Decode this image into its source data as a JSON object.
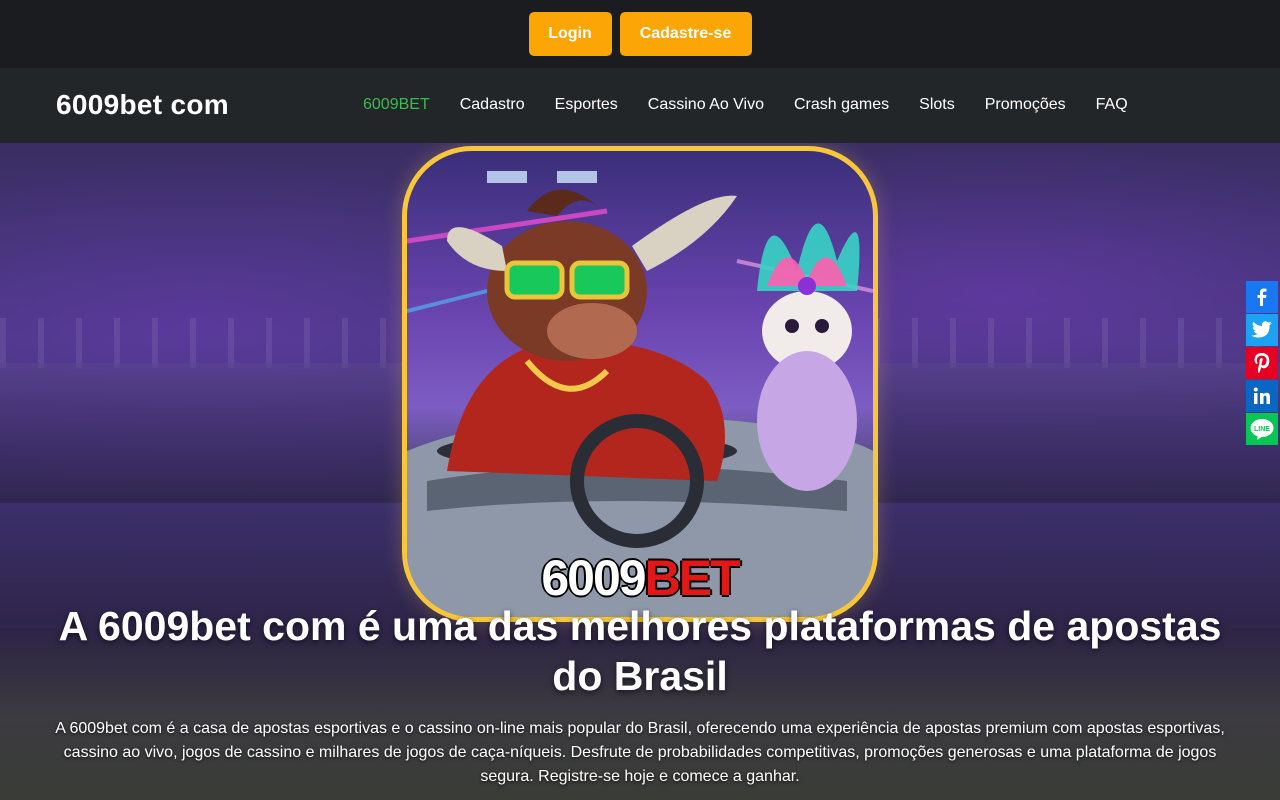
{
  "header": {
    "login_label": "Login",
    "signup_label": "Cadastre-se"
  },
  "navbar": {
    "brand": "6009bet com",
    "items": [
      {
        "label": "6009BET",
        "active": true
      },
      {
        "label": "Cadastro"
      },
      {
        "label": "Esportes"
      },
      {
        "label": "Cassino Ao Vivo"
      },
      {
        "label": "Crash games"
      },
      {
        "label": "Slots"
      },
      {
        "label": "Promoções"
      },
      {
        "label": "FAQ"
      }
    ]
  },
  "hero": {
    "promo_logo_number": "6009",
    "promo_logo_text": "BET",
    "headline": "A 6009bet com é uma das melhores plataformas de apostas do Brasil",
    "description": "A 6009bet com é a casa de apostas esportivas e o cassino on-line mais popular do Brasil, oferecendo uma experiência de apostas premium com apostas esportivas, cassino ao vivo, jogos de cassino e milhares de jogos de caça-níqueis. Desfrute de probabilidades competitivas, promoções generosas e uma plataforma de jogos segura. Registre-se hoje e comece a ganhar."
  },
  "share_bar": {
    "icons": [
      "facebook-icon",
      "twitter-icon",
      "pinterest-icon",
      "linkedin-icon",
      "line-icon"
    ],
    "colors": {
      "facebook": "#1877f2",
      "twitter": "#1da1f2",
      "pinterest": "#e60023",
      "linkedin": "#0a66c2",
      "line": "#06c755"
    }
  },
  "colors": {
    "accent_button": "#fca506",
    "nav_active": "#3fb950",
    "topbar_bg": "#1b1c1f",
    "navbar_bg": "#232629"
  }
}
